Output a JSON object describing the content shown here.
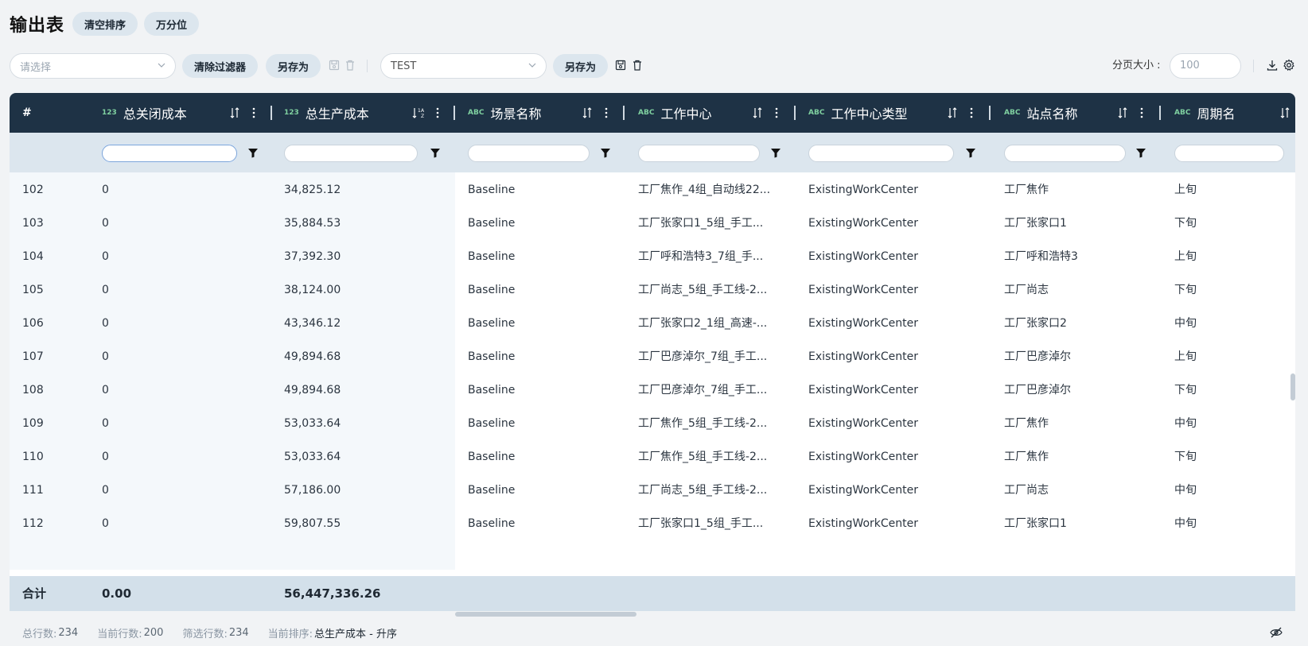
{
  "header": {
    "title": "输出表",
    "clear_sort": "清空排序",
    "per_ten_thousand": "万分位"
  },
  "toolbar": {
    "filter_select_placeholder": "请选择",
    "clear_filters": "清除过滤器",
    "save_as_1": "另存为",
    "view_select_value": "TEST",
    "save_as_2": "另存为",
    "page_size_label": "分页大小 :",
    "page_size_value": "100"
  },
  "table": {
    "index_header": "#",
    "columns": [
      {
        "type": "123",
        "name": "总关闭成本"
      },
      {
        "type": "123",
        "name": "总生产成本"
      },
      {
        "type": "ABC",
        "name": "场景名称"
      },
      {
        "type": "ABC",
        "name": "工作中心"
      },
      {
        "type": "ABC",
        "name": "工作中心类型"
      },
      {
        "type": "ABC",
        "name": "站点名称"
      },
      {
        "type": "ABC",
        "name": "周期名"
      }
    ],
    "rows": [
      [
        "102",
        "0",
        "34,825.12",
        "Baseline",
        "工厂焦作_4组_自动线22...",
        "ExistingWorkCenter",
        "工厂焦作",
        "上旬"
      ],
      [
        "103",
        "0",
        "35,884.53",
        "Baseline",
        "工厂张家口1_5组_手工...",
        "ExistingWorkCenter",
        "工厂张家口1",
        "下旬"
      ],
      [
        "104",
        "0",
        "37,392.30",
        "Baseline",
        "工厂呼和浩特3_7组_手...",
        "ExistingWorkCenter",
        "工厂呼和浩特3",
        "上旬"
      ],
      [
        "105",
        "0",
        "38,124.00",
        "Baseline",
        "工厂尚志_5组_手工线-2...",
        "ExistingWorkCenter",
        "工厂尚志",
        "下旬"
      ],
      [
        "106",
        "0",
        "43,346.12",
        "Baseline",
        "工厂张家口2_1组_高速-...",
        "ExistingWorkCenter",
        "工厂张家口2",
        "中旬"
      ],
      [
        "107",
        "0",
        "49,894.68",
        "Baseline",
        "工厂巴彦淖尔_7组_手工...",
        "ExistingWorkCenter",
        "工厂巴彦淖尔",
        "上旬"
      ],
      [
        "108",
        "0",
        "49,894.68",
        "Baseline",
        "工厂巴彦淖尔_7组_手工...",
        "ExistingWorkCenter",
        "工厂巴彦淖尔",
        "下旬"
      ],
      [
        "109",
        "0",
        "53,033.64",
        "Baseline",
        "工厂焦作_5组_手工线-2...",
        "ExistingWorkCenter",
        "工厂焦作",
        "中旬"
      ],
      [
        "110",
        "0",
        "53,033.64",
        "Baseline",
        "工厂焦作_5组_手工线-2...",
        "ExistingWorkCenter",
        "工厂焦作",
        "下旬"
      ],
      [
        "111",
        "0",
        "57,186.00",
        "Baseline",
        "工厂尚志_5组_手工线-2...",
        "ExistingWorkCenter",
        "工厂尚志",
        "中旬"
      ],
      [
        "112",
        "0",
        "59,807.55",
        "Baseline",
        "工厂张家口1_5组_手工...",
        "ExistingWorkCenter",
        "工厂张家口1",
        "中旬"
      ]
    ],
    "totals": {
      "label": "合计",
      "closing_cost": "0.00",
      "production_cost": "56,447,336.26"
    }
  },
  "footer": {
    "total_rows_label": "总行数:",
    "total_rows": "234",
    "current_rows_label": "当前行数:",
    "current_rows": "200",
    "filtered_rows_label": "筛选行数:",
    "filtered_rows": "234",
    "current_sort_label": "当前排序:",
    "current_sort": "总生产成本 - 升序"
  },
  "colors": {
    "header_bg": "#1e3245",
    "filter_bg": "#dce6ee",
    "total_bg": "#d3e0ea",
    "type_badge": "#7fd0a0"
  }
}
